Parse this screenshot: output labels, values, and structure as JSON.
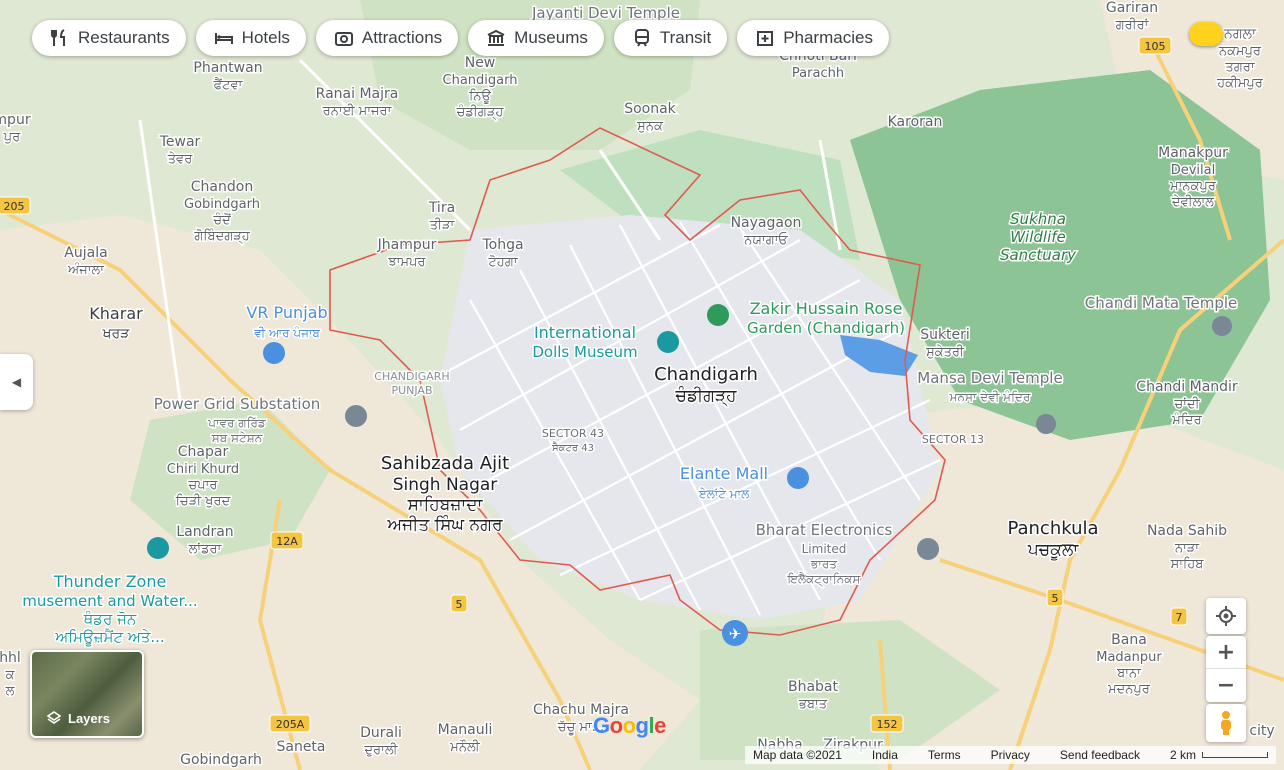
{
  "filter_chips": [
    {
      "label": "Restaurants",
      "icon": "fork-knife-icon"
    },
    {
      "label": "Hotels",
      "icon": "bed-icon"
    },
    {
      "label": "Attractions",
      "icon": "camera-icon"
    },
    {
      "label": "Museums",
      "icon": "museum-icon"
    },
    {
      "label": "Transit",
      "icon": "train-icon"
    },
    {
      "label": "Pharmacies",
      "icon": "pharmacy-icon"
    }
  ],
  "place_labels": [
    {
      "id": "jayanti-devi-temple",
      "lines": [
        "Jayanti Devi Temple"
      ],
      "kind": "poi"
    },
    {
      "id": "gariran",
      "lines": [
        "Gariran",
        "ਗਰੀਰਾਂ"
      ],
      "kind": "town"
    },
    {
      "id": "phantwan",
      "lines": [
        "Phantwan",
        "ਫੈਂਟਵਾ"
      ],
      "kind": "town"
    },
    {
      "id": "ranai-majra",
      "lines": [
        "Ranai Majra",
        "ਰਨਾਈ ਮਾਜਰਾ"
      ],
      "kind": "town"
    },
    {
      "id": "new-chandigarh",
      "lines": [
        "New",
        "Chandigarh",
        "ਨਿਊ",
        "ਚੰਡੀਗੜ੍ਹ"
      ],
      "kind": "town"
    },
    {
      "id": "chhoti-bari-parachh",
      "lines": [
        "Chhoti Bari",
        "Parachh"
      ],
      "kind": "town"
    },
    {
      "id": "nagla",
      "lines": [
        "ਨਗਲਾ",
        "ਨਕਮਪੁਰ",
        "ਤਗਰਾ",
        "ਹਕੀਮਪੁਰ"
      ],
      "kind": "town"
    },
    {
      "id": "soonak",
      "lines": [
        "Soonak",
        "ਸੁਨਕ"
      ],
      "kind": "town"
    },
    {
      "id": "karoran",
      "lines": [
        "Karoran"
      ],
      "kind": "town"
    },
    {
      "id": "tewar",
      "lines": [
        "Tewar",
        "ਤੇਵਰ"
      ],
      "kind": "town"
    },
    {
      "id": "manakpur-devilal",
      "lines": [
        "Manakpur",
        "Devilal",
        "ਮਾਨਕਪੁਰ",
        "ਦੇਵੀਲਾਲ"
      ],
      "kind": "town"
    },
    {
      "id": "chandon-gobindgarh",
      "lines": [
        "Chandon",
        "Gobindgarh",
        "ਚੰਦੋਂ",
        "ਗੋਬਿੰਦਗੜ੍ਹ"
      ],
      "kind": "town"
    },
    {
      "id": "tira",
      "lines": [
        "Tira",
        "ਤੀੜਾ"
      ],
      "kind": "town"
    },
    {
      "id": "nayagaon",
      "lines": [
        "Nayagaon",
        "ਨਯਾਗਾਓ"
      ],
      "kind": "town"
    },
    {
      "id": "sukhna",
      "lines": [
        "Sukhna",
        "Wildlife",
        "Sanctuary"
      ],
      "kind": "park"
    },
    {
      "id": "jhampur",
      "lines": [
        "Jhampur",
        "ਝਾਮਪਰ"
      ],
      "kind": "town"
    },
    {
      "id": "tohga",
      "lines": [
        "Tohga",
        "ਟੋਹਗਾ"
      ],
      "kind": "town"
    },
    {
      "id": "aujala",
      "lines": [
        "Aujala",
        "ਅੰਜਾਲਾ"
      ],
      "kind": "town"
    },
    {
      "id": "chandi-mata-temple",
      "lines": [
        "Chandi Mata Temple"
      ],
      "kind": "poi"
    },
    {
      "id": "vr-punjab",
      "lines": [
        "VR Punjab",
        "ਵੀ ਆਰ ਪੰਜਾਬ"
      ],
      "kind": "poi-blue"
    },
    {
      "id": "zakir-hussain",
      "lines": [
        "Zakir Hussain Rose",
        "Garden (Chandigarh)"
      ],
      "kind": "poi-green"
    },
    {
      "id": "kharar",
      "lines": [
        "Kharar",
        "ਖਰੜ"
      ],
      "kind": "town-big"
    },
    {
      "id": "sukteri",
      "lines": [
        "Sukteri",
        "ਸੁਕੇਤਰੀ"
      ],
      "kind": "town"
    },
    {
      "id": "dolls-museum",
      "lines": [
        "International",
        "Dolls Museum"
      ],
      "kind": "poi-teal"
    },
    {
      "id": "chandigarh",
      "lines": [
        "Chandigarh",
        "ਚੰਡੀਗੜ੍ਹ"
      ],
      "kind": "city"
    },
    {
      "id": "mansa-devi",
      "lines": [
        "Mansa Devi Temple",
        "ਮਨਸਾ ਦੇਵੀ ਮੰਦਿਰ"
      ],
      "kind": "poi"
    },
    {
      "id": "chandi-mandir",
      "lines": [
        "Chandi Mandir",
        "ਚਾਂਦੀ",
        "ਮੰਦਿਰ"
      ],
      "kind": "town"
    },
    {
      "id": "power-grid",
      "lines": [
        "Power Grid Substation",
        "ਪਾਵਰ ਗਰਿੱਡ",
        "ਸਬ ਸਟੇਸ਼ਨ"
      ],
      "kind": "poi"
    },
    {
      "id": "sector-43",
      "lines": [
        "SECTOR 43",
        "ਸੈਕਟਰ 43"
      ],
      "kind": "sector"
    },
    {
      "id": "sector-13",
      "lines": [
        "SECTOR 13"
      ],
      "kind": "sector"
    },
    {
      "id": "chapar",
      "lines": [
        "Chapar",
        "Chiri Khurd",
        "ਚਪਾਰ",
        "ਚਿੜੀ ਖੁਰਦ"
      ],
      "kind": "town"
    },
    {
      "id": "mohali",
      "lines": [
        "Sahibzada Ajit",
        "Singh Nagar",
        "ਸਾਹਿਬਜ਼ਾਦਾ",
        "ਅਜੀਤ ਸਿੰਘ ਨਗਰ"
      ],
      "kind": "city"
    },
    {
      "id": "elante",
      "lines": [
        "Elante Mall",
        "ਏਲਾਂਟੇ ਮਾਲ"
      ],
      "kind": "poi-blue"
    },
    {
      "id": "bharat-electronics",
      "lines": [
        "Bharat Electronics",
        "Limited",
        "ਭਾਰਤ",
        "ਇਲੈਕਟ੍ਰਾਨਿਕਸ"
      ],
      "kind": "poi"
    },
    {
      "id": "panchkula",
      "lines": [
        "Panchkula",
        "ਪਚਕੂਲਾ"
      ],
      "kind": "city"
    },
    {
      "id": "nada-sahib",
      "lines": [
        "Nada Sahib",
        "ਨਾੜਾ",
        "ਸਾਹਿਬ"
      ],
      "kind": "town"
    },
    {
      "id": "landran",
      "lines": [
        "Landran",
        "ਲਾਂਡਰਾ"
      ],
      "kind": "town"
    },
    {
      "id": "thunder-zone",
      "lines": [
        "Thunder Zone",
        "musement and Water...",
        "ਥੰਡਰ ਜੋਨ",
        "ਅਮਿਊਜ਼ਮੈਂਟ ਅਤੇ..."
      ],
      "kind": "poi-teal"
    },
    {
      "id": "bana-madanpur",
      "lines": [
        "Bana",
        "Madanpur",
        "ਬਾਨਾ",
        "ਮਦਨਪੁਰ"
      ],
      "kind": "town"
    },
    {
      "id": "bhabat",
      "lines": [
        "Bhabat",
        "ਭਬਾਤ"
      ],
      "kind": "town"
    },
    {
      "id": "chachu-majra",
      "lines": [
        "Chachu Majra",
        "ਚੱਚੂ ਮਾ..."
      ],
      "kind": "town"
    },
    {
      "id": "durali",
      "lines": [
        "Durali",
        "ਦੁਰਾਲੀ"
      ],
      "kind": "town"
    },
    {
      "id": "manauli",
      "lines": [
        "Manauli",
        "ਮਨੌਲੀ"
      ],
      "kind": "town"
    },
    {
      "id": "saneta",
      "lines": [
        "Saneta"
      ],
      "kind": "town"
    },
    {
      "id": "gobindgarh",
      "lines": [
        "Gobindgarh"
      ],
      "kind": "town"
    },
    {
      "id": "zirakpur",
      "lines": [
        "Zirakpur"
      ],
      "kind": "town"
    },
    {
      "id": "nabha",
      "lines": [
        "Nabha"
      ],
      "kind": "town"
    },
    {
      "id": "chandigarh-punjab",
      "lines": [
        "CHANDIGARH",
        "PUNJAB"
      ],
      "kind": "boundary"
    },
    {
      "id": "edge-mp",
      "lines": [
        "mpur",
        "ਪੁਰ"
      ],
      "kind": "town"
    },
    {
      "id": "edge-chhil",
      "lines": [
        "hhl",
        "ਕ",
        "ਲ"
      ],
      "kind": "town"
    },
    {
      "id": "edge-city",
      "lines": [
        "city"
      ],
      "kind": "town"
    }
  ],
  "road_shields": [
    "105",
    "205",
    "12A",
    "5",
    "5",
    "7",
    "205A",
    "152"
  ],
  "map_controls": {
    "zoom_in": "+",
    "zoom_out": "−"
  },
  "layers_button": {
    "label": "Layers"
  },
  "google_logo": "Google",
  "footer": {
    "map_data": "Map data ©2021",
    "region": "India",
    "terms": "Terms",
    "privacy": "Privacy",
    "feedback": "Send feedback",
    "scale_label": "2 km"
  },
  "colors": {
    "land": "#eef0e6",
    "city_area": "#e8e8ec",
    "forest": "#7fbf8a",
    "park": "#bfe3c2",
    "water": "#5c9ee6",
    "boundary": "#e05a4f",
    "highway": "#f6d17a",
    "poi_blue": "#4a8fe0",
    "poi_green": "#2f9a5c",
    "poi_teal": "#1a9aa0"
  }
}
